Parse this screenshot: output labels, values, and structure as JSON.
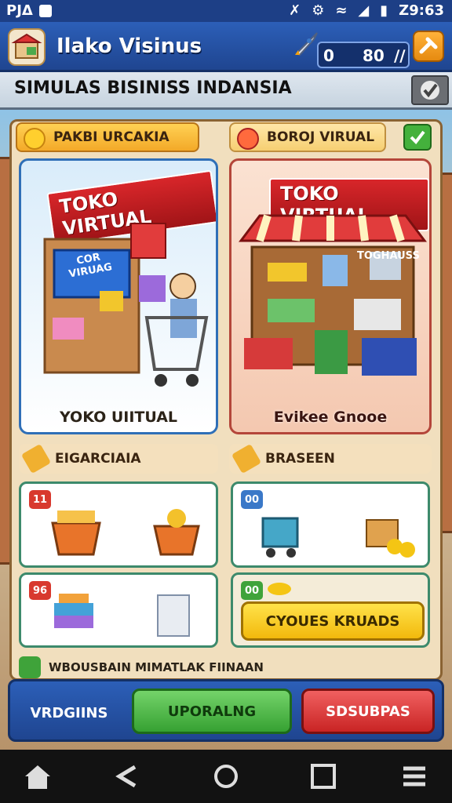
{
  "status_bar": {
    "left_text": "PJΔ",
    "time": "Z9:63"
  },
  "header": {
    "title": "Ilako Visinus",
    "counter_left": "0",
    "counter_mid": "80",
    "counter_right": "∕∕"
  },
  "banner": {
    "title": "SIMULAS BISINISS INDANSIA"
  },
  "left_section": {
    "label": "PAKBI URCAKIA",
    "panel_title": "TOKO VIRTUAL",
    "panel_sign": "COR VIRUAG",
    "panel_caption": "YOKO UIITUAL",
    "sub_label": "EIGARCIAIA",
    "cards": [
      {
        "badge": "11"
      },
      {
        "badge": "96"
      }
    ]
  },
  "right_section": {
    "label": "BOROJ VIRUAL",
    "panel_title": "TOKO VIRTUAL",
    "panel_sign": "TOGHAUSS",
    "panel_caption": "Evikee Gnooe",
    "sub_label": "BRASEEN",
    "cards": [
      {
        "badge": "00"
      },
      {
        "badge": "00",
        "button": "CYOUES KRUADS"
      }
    ]
  },
  "tip": {
    "text": "WBOUSBAIN MIMATLAK FIINAAN"
  },
  "buttons": {
    "blue": "VRDGIINS",
    "green": "UPORALNG",
    "red": "SDSUBPAS"
  },
  "colors": {
    "blue": "#1f4590",
    "green": "#3fa33a",
    "red": "#cc2a2a",
    "yellow": "#f4c514",
    "orange": "#f0a020"
  }
}
